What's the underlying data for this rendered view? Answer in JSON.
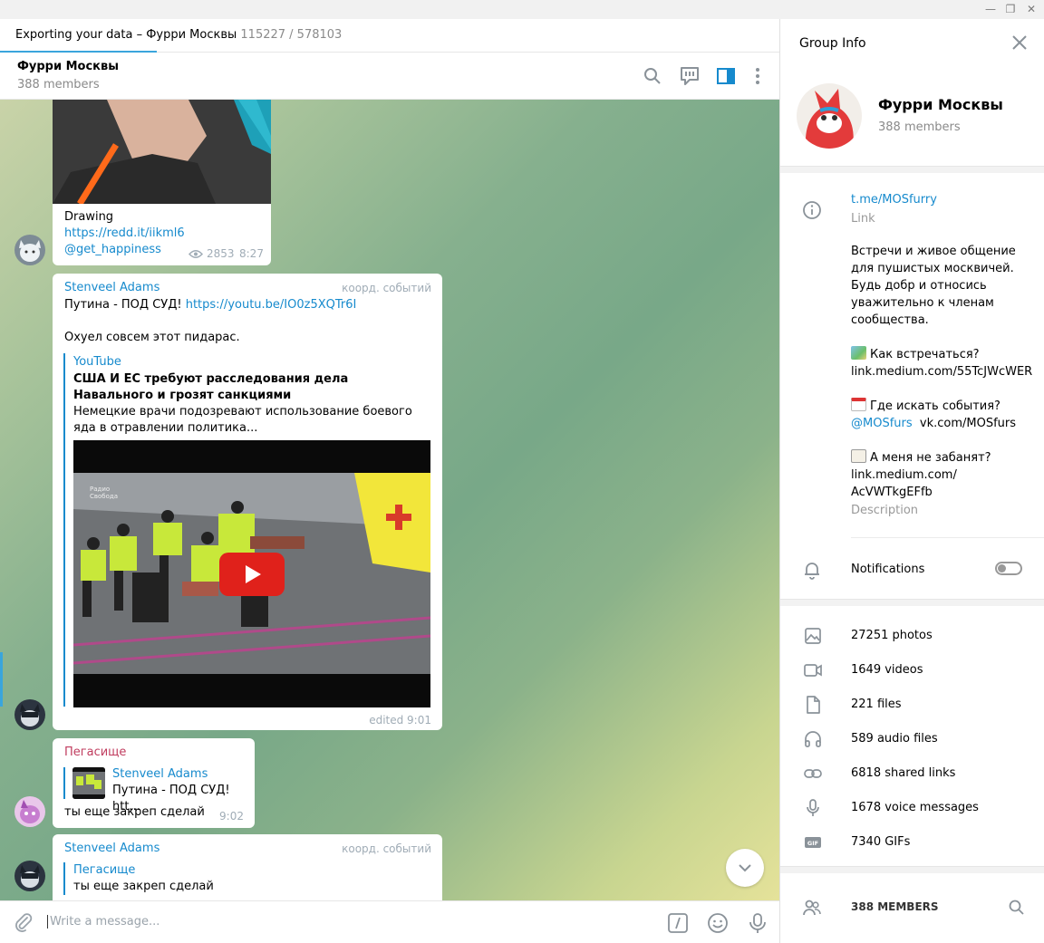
{
  "window": {
    "minimize_glyph": "—",
    "restore_glyph": "❐",
    "close_glyph": "✕"
  },
  "export_bar": {
    "title": "Exporting your data – Фурри Москвы",
    "progress_text": "115227 / 578103",
    "progress_fraction": 0.3
  },
  "chat_header": {
    "title": "Фурри Москвы",
    "subtitle": "388 members",
    "icons": [
      "search-icon",
      "discuss-icon",
      "sidebar-toggle-icon",
      "more-vertical-icon"
    ]
  },
  "messages": {
    "m1": {
      "caption": "Drawing",
      "link": "https://redd.it/iikml6",
      "mention": "@get_happiness",
      "views": "2853",
      "time": "8:27"
    },
    "m2": {
      "sender": "Stenveel Adams",
      "rank": "коорд. событий",
      "text_prefix": "Путина - ПОД СУД! ",
      "link": "https://youtu.be/IO0z5XQTr6I",
      "text2": "Охуел совсем этот пидарас.",
      "preview_site": "YouTube",
      "preview_title": "США И ЕС требуют расследования дела Навального и грозят санкциями",
      "preview_desc": "Немецкие врачи подозревают использование боевого яда в отравлении политика...",
      "watermark": "Радио Свобода",
      "meta": "edited 9:01"
    },
    "m3": {
      "sender": "Пегасище",
      "reply_name": "Stenveel Adams",
      "reply_text": "Путина - ПОД СУД! htt...",
      "text": "ты еще закреп сделай",
      "time": "9:02"
    },
    "m4": {
      "sender": "Stenveel Adams",
      "rank": "коорд. событий",
      "reply_name": "Пегасище",
      "reply_text": "ты еще закреп сделай"
    }
  },
  "composer": {
    "placeholder": "Write a message..."
  },
  "group_info": {
    "title": "Group Info",
    "name": "Фурри Москвы",
    "members": "388 members",
    "link": "t.me/MOSfurry",
    "link_label": "Link",
    "desc_intro": [
      "Встречи и живое общение",
      "для пушистых москвичей.",
      "Будь добр и относись",
      "уважительно к членам",
      "сообщества."
    ],
    "desc_q1": "Как встречаться?",
    "desc_q1_link": "link.medium.com/55TcJWcWER",
    "desc_q2": "Где искать события?",
    "desc_q2_mention": "@MOSfurs",
    "desc_q2_link": "vk.com/MOSfurs",
    "desc_q3": "А меня не забанят?",
    "desc_q3_link1": "link.medium.com/",
    "desc_q3_link2": "AcVWTkgEFfb",
    "desc_label": "Description",
    "notifications_label": "Notifications",
    "notifications_on": false,
    "media": [
      {
        "icon": "photo-icon",
        "label": "27251 photos"
      },
      {
        "icon": "video-icon",
        "label": "1649 videos"
      },
      {
        "icon": "file-icon",
        "label": "221 files"
      },
      {
        "icon": "headphones-icon",
        "label": "589 audio files"
      },
      {
        "icon": "link-icon",
        "label": "6818 shared links"
      },
      {
        "icon": "microphone-icon",
        "label": "1678 voice messages"
      },
      {
        "icon": "gif-icon",
        "label": "7340 GIFs"
      }
    ],
    "members_header": "388 MEMBERS"
  },
  "colors": {
    "accent": "#168acd",
    "pegasus_name": "#c03d5f",
    "progress": "#3aa5dc"
  }
}
